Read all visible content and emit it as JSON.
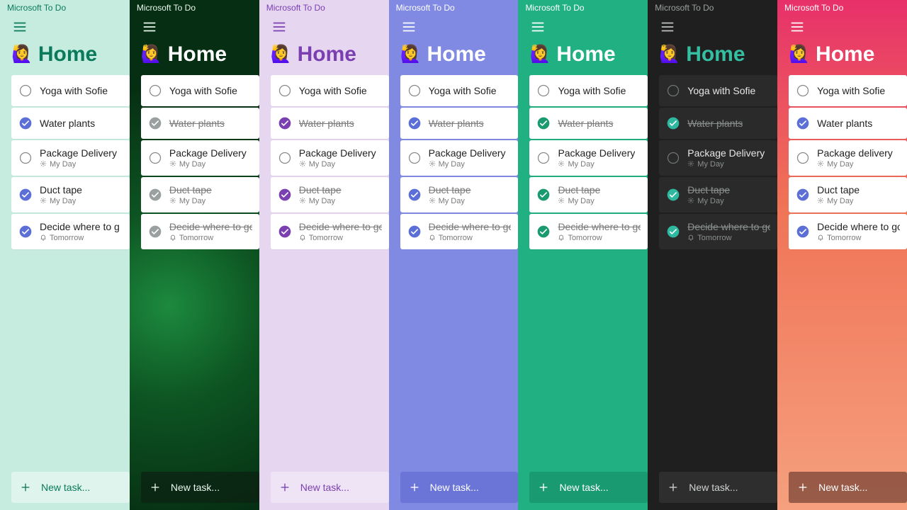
{
  "app_title": "Microsoft To Do",
  "list_title": "Home",
  "new_task_placeholder": "New task...",
  "avatar_emoji": "🙋‍♀️",
  "meta": {
    "myday": "My Day",
    "tomorrow": "Tomorrow"
  },
  "themes": [
    {
      "id": "mint",
      "accent": "#0a7a5a",
      "check_fill": "#5b6fd6",
      "strike_completed": false,
      "dark_cards": false
    },
    {
      "id": "fern",
      "accent": "#ffffff",
      "check_fill": "#9aa0a0",
      "strike_completed": true,
      "dark_cards": false
    },
    {
      "id": "lav",
      "accent": "#7a3fb0",
      "check_fill": "#7a3fb0",
      "strike_completed": true,
      "dark_cards": false
    },
    {
      "id": "peri",
      "accent": "#ffffff",
      "check_fill": "#5b6fd6",
      "strike_completed": true,
      "dark_cards": false
    },
    {
      "id": "teal",
      "accent": "#ffffff",
      "check_fill": "#1a9a70",
      "strike_completed": true,
      "dark_cards": false
    },
    {
      "id": "dark",
      "accent": "#34bfa3",
      "check_fill": "#2fb8a0",
      "strike_completed": true,
      "dark_cards": true
    },
    {
      "id": "coral",
      "accent": "#ffffff",
      "check_fill": "#5b6fd6",
      "strike_completed": false,
      "dark_cards": false
    }
  ],
  "tasks": [
    {
      "title": "Yoga with Sofie",
      "done": false,
      "meta": null
    },
    {
      "title": "Water plants",
      "done": true,
      "meta": null
    },
    {
      "title": "Package Delivery",
      "done": false,
      "meta": "myday"
    },
    {
      "title": "Duct tape",
      "done": true,
      "meta": "myday"
    },
    {
      "title": "Decide where to go for the",
      "done": true,
      "meta": "tomorrow"
    }
  ],
  "task_title_overrides": {
    "coral": {
      "2": "Package delivery"
    },
    "mint": {
      "4": "Decide where to g"
    },
    "fern": {
      "4": "Decide where to go fo"
    },
    "lav": {
      "4": "Decide where to go for"
    },
    "peri": {
      "4": "Decide where to go fo"
    },
    "teal": {
      "4": "Decide where to go fo"
    },
    "dark": {
      "4": "Decide where to go for th"
    },
    "coral2": {
      "4": "Decide where to go fo"
    }
  }
}
